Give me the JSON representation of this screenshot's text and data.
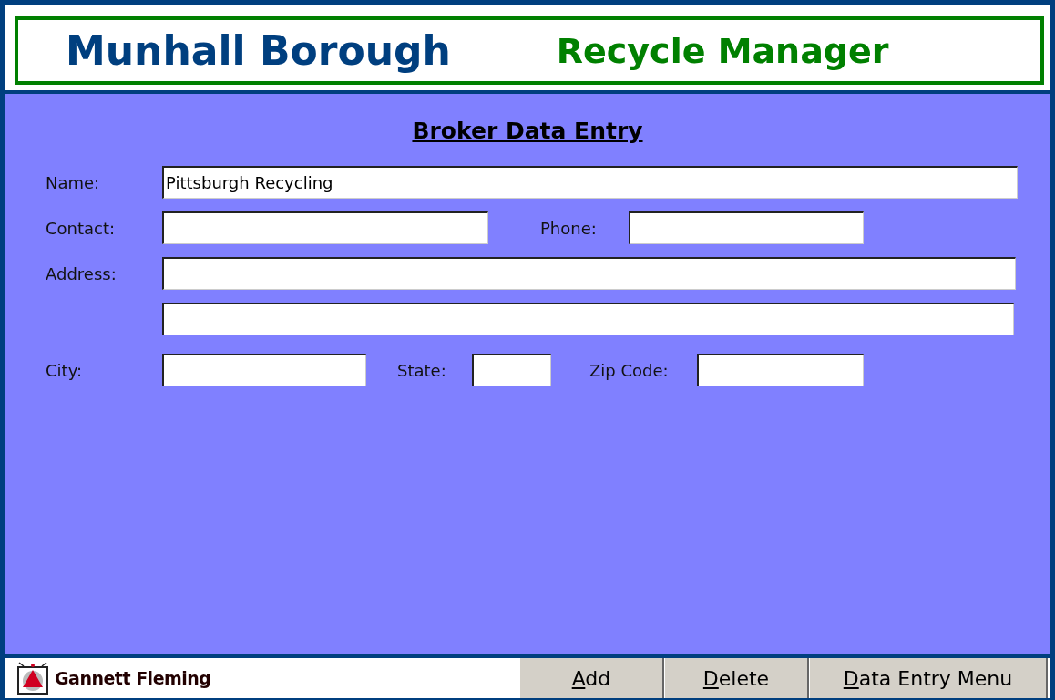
{
  "header": {
    "title": "Munhall Borough",
    "subtitle": "Recycle Manager"
  },
  "form": {
    "title": "Broker Data Entry",
    "rows": [
      [
        {
          "label": "Name:",
          "value": "Pittsburgh Recycling"
        }
      ],
      [
        {
          "label": "Contact:"
        },
        {
          "label": "Phone:"
        }
      ],
      [
        {
          "label": "Address:"
        }
      ],
      [
        {}
      ],
      [
        {
          "label": "City:"
        },
        {
          "label": "State:"
        },
        {
          "label": "Zip Code:"
        }
      ]
    ]
  },
  "footer": {
    "company": "Gannett Fleming",
    "buttons": [
      {
        "label": "Add"
      },
      {
        "label": "Delete"
      },
      {
        "label": "Data Entry Menu"
      }
    ]
  }
}
